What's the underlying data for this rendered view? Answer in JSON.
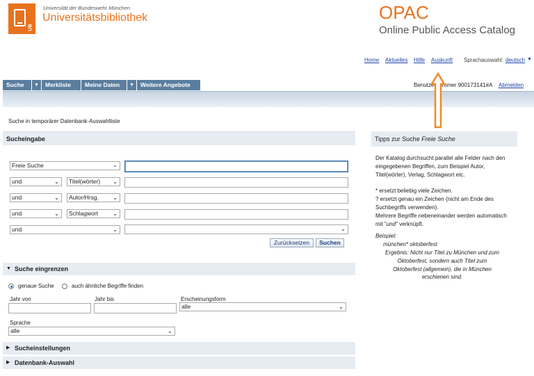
{
  "header": {
    "logo_text": "UB",
    "uni_small": "Universität der Bundeswehr München",
    "uni_big": "Universitätsbibliothek",
    "opac_title": "OPAC",
    "opac_sub": "Online Public Access Catalog",
    "accent": "#e8731e"
  },
  "toplinks": [
    "Home",
    "Aktuelles",
    "Hilfe",
    "Auskunft"
  ],
  "language": {
    "label": "Sprachauswahl:",
    "value": "deutsch"
  },
  "nav": {
    "items": [
      "Suche",
      "Merkliste",
      "Meine Daten",
      "Weitere Angebote"
    ],
    "user_text": "Benutzernummer 900173141#A",
    "logout": "Abmelden"
  },
  "main": {
    "temp_text": "Suche in temporärer Datenbank-Auswahlliste",
    "search_section": "Sucheingabe",
    "rows": [
      {
        "op": "",
        "field": "Freie Suche",
        "value": ""
      },
      {
        "op": "und",
        "field": "Titel(wörter)",
        "value": ""
      },
      {
        "op": "und",
        "field": "Autor/Hrsg.",
        "value": ""
      },
      {
        "op": "und",
        "field": "Schlagwort",
        "value": ""
      },
      {
        "op": "und",
        "field": "",
        "value": ""
      }
    ],
    "reset_label": "Zurücksetzen",
    "search_label": "Suchen",
    "limit_section": "Suche eingrenzen",
    "radio_exact": "genaue Suche",
    "radio_similar": "auch ähnliche Begriffe finden",
    "year_from_label": "Jahr von",
    "year_to_label": "Jahr  bis",
    "form_label": "Erscheinungsform",
    "form_value": "alle",
    "lang_label": "Sprache",
    "lang_value": "alle",
    "settings_section": "Sucheinstellungen",
    "db_section": "Datenbank-Auswahl"
  },
  "tips": {
    "title_prefix": "Tipps zur Suche ",
    "title_em": "Freie Suche",
    "p1": "Der Katalog durchsucht parallel alle Felder nach den eingegebenen Begriffen, zum Beispiel Autor, Titel(wörter), Verlag, Schlagwort etc.",
    "p2a": "* ersetzt beliebig viele Zeichen.",
    "p2b": "? ersetzt genau ein Zeichen (nicht am Ende des Suchbegriffs verwenden).",
    "p2c_pre": "Mehrere Begriffe nebeneinander werden automatisch mit \"",
    "p2c_em": "und",
    "p2c_post": "\" verknüpft.",
    "example_label": "Beispiel:",
    "example_query": "münchen* oktoberfest",
    "example_result": "Ergebnis: Nicht nur Titel zu München und zum Oktoberfest, sondern auch Titel zum Oktoberfest (allgemein), die in München erschienen sind."
  }
}
